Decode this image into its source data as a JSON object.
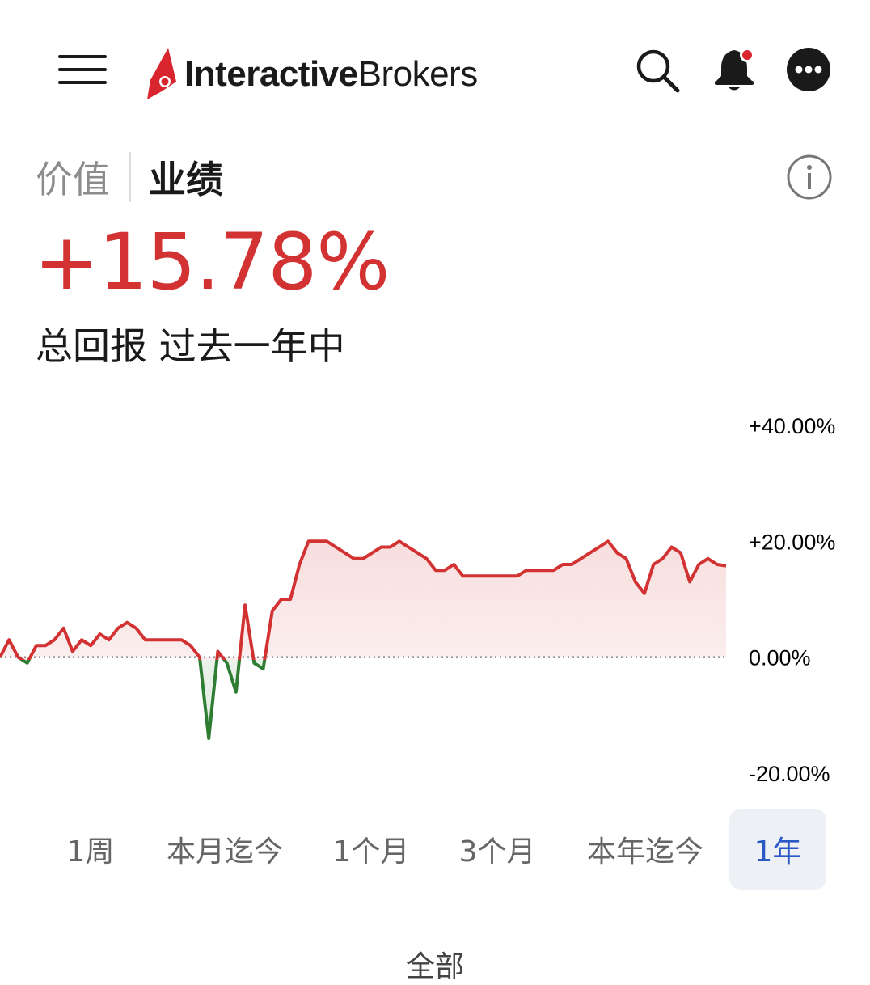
{
  "header": {
    "logo_bold": "Interactive",
    "logo_light": "Brokers",
    "accent_color": "#d9262e"
  },
  "icons": [
    "menu-icon",
    "search-icon",
    "bell-icon",
    "more-icon",
    "info-icon"
  ],
  "tabs": [
    {
      "label": "价值",
      "active": false
    },
    {
      "label": "业绩",
      "active": true
    }
  ],
  "performance": {
    "value": "+15.78%",
    "caption": "总回报 过去一年中",
    "positive_color": "#d23232",
    "negative_color": "#2e7d32"
  },
  "chart_data": {
    "type": "line",
    "title": "",
    "xlabel": "",
    "ylabel": "",
    "ylim": [
      -20,
      40
    ],
    "y_ticks": [
      "+40.00%",
      "+20.00%",
      "0.00%",
      "-20.00%"
    ],
    "y_tick_values": [
      40,
      20,
      0,
      -20
    ],
    "grid": false,
    "baseline": 0,
    "series": [
      {
        "values": [
          0,
          3,
          0,
          -1,
          2,
          2,
          3,
          5,
          1,
          3,
          2,
          4,
          3,
          5,
          6,
          5,
          3,
          3,
          3,
          3,
          3,
          2,
          0,
          -14,
          1,
          -1,
          -6,
          9,
          -1,
          -2,
          8,
          10,
          10,
          16,
          20,
          20,
          20,
          19,
          18,
          17,
          17,
          18,
          19,
          19,
          20,
          19,
          18,
          17,
          15,
          15,
          16,
          14,
          14,
          14,
          14,
          14,
          14,
          14,
          15,
          15,
          15,
          15,
          16,
          16,
          17,
          18,
          19,
          20,
          18,
          17,
          13,
          11,
          16,
          17,
          19,
          18,
          13,
          16,
          17,
          16,
          15.78
        ]
      }
    ]
  },
  "ranges": [
    {
      "label": "1周",
      "active": false
    },
    {
      "label": "本月迄今",
      "active": false
    },
    {
      "label": "1个月",
      "active": false
    },
    {
      "label": "3个月",
      "active": false
    },
    {
      "label": "本年迄今",
      "active": false
    },
    {
      "label": "1年",
      "active": true
    }
  ],
  "all_label": "全部"
}
